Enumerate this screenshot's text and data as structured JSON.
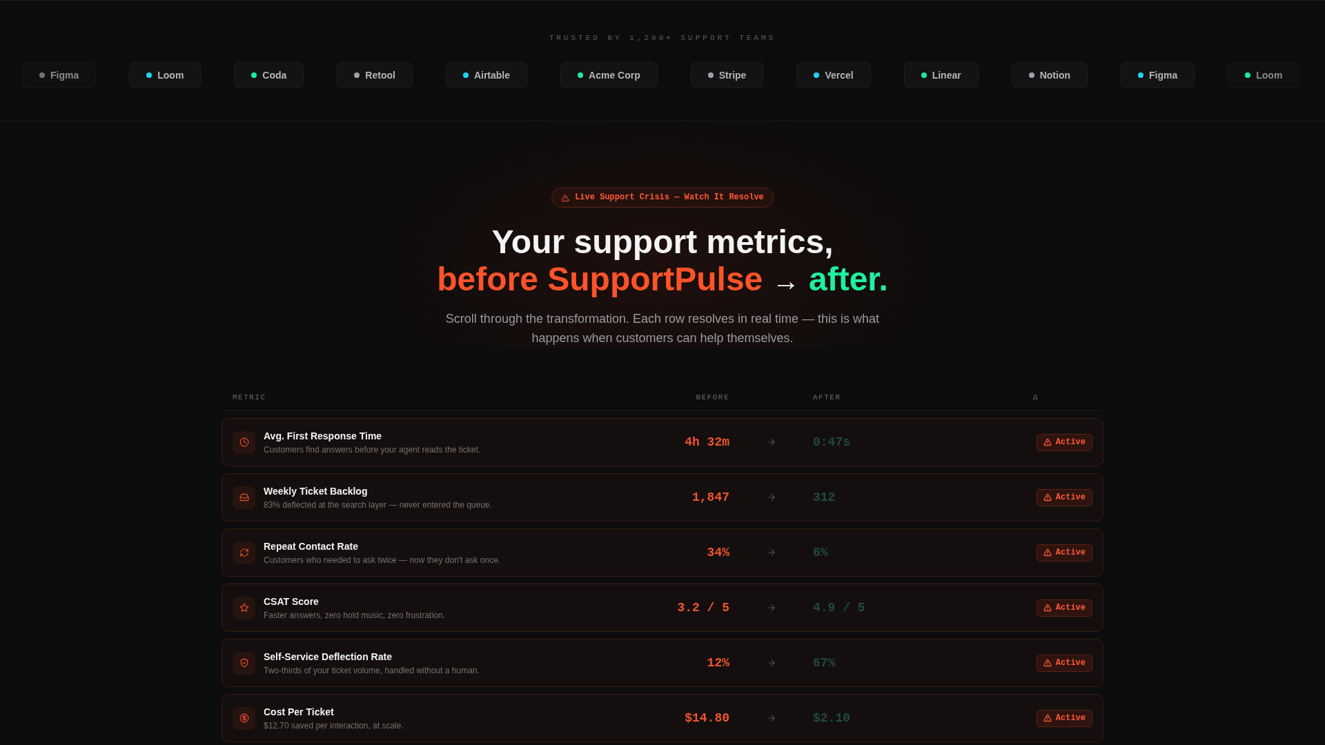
{
  "trusted_by": {
    "label": "TRUSTED BY 1,200+ SUPPORT TEAMS",
    "logos": [
      {
        "name": "Figma",
        "color": "#717175"
      },
      {
        "name": "Loom",
        "color": "#22d3ee"
      },
      {
        "name": "Coda",
        "color": "#1de9a0"
      },
      {
        "name": "Retool",
        "color": "#a1a1aa"
      },
      {
        "name": "Airtable",
        "color": "#22d3ee"
      },
      {
        "name": "Acme Corp",
        "color": "#1de9a0"
      },
      {
        "name": "Stripe",
        "color": "#a1a1aa"
      },
      {
        "name": "Vercel",
        "color": "#22d3ee"
      },
      {
        "name": "Linear",
        "color": "#1de9a0"
      },
      {
        "name": "Notion",
        "color": "#a1a1aa"
      },
      {
        "name": "Figma",
        "color": "#22d3ee"
      },
      {
        "name": "Loom",
        "color": "#1de9a0"
      }
    ]
  },
  "hero": {
    "badge": "Live Support Crisis — Watch It Resolve",
    "headline": {
      "line_1": "Your support metrics,",
      "before": "before SupportPulse",
      "arrow": "→",
      "after": "after."
    },
    "subtitle": "Scroll through the transformation. Each row resolves in real time — this is what happens when customers can help themselves."
  },
  "table": {
    "columns": [
      "METRIC",
      "BEFORE",
      "AFTER",
      "Δ"
    ],
    "rows": [
      {
        "kind": "time",
        "title": "Avg. First Response Time",
        "description": "Customers find answers before your agent reads the ticket.",
        "before": "4h 32m",
        "after": "0:47s",
        "status": "Active"
      },
      {
        "kind": "backlog",
        "title": "Weekly Ticket Backlog",
        "description": "83% deflected at the search layer — never entered the queue.",
        "before": "1,847",
        "after": "312",
        "status": "Active"
      },
      {
        "kind": "repeat",
        "title": "Repeat Contact Rate",
        "description": "Customers who needed to ask twice — now they don't ask once.",
        "before": "34%",
        "after": "6%",
        "status": "Active"
      },
      {
        "kind": "rating",
        "title": "CSAT Score",
        "description": "Faster answers, zero hold music, zero frustration.",
        "before": "3.2 / 5",
        "after": "4.9 / 5",
        "status": "Active"
      },
      {
        "kind": "deflection",
        "title": "Self-Service Deflection Rate",
        "description": "Two-thirds of your ticket volume, handled without a human.",
        "before": "12%",
        "after": "67%",
        "status": "Active"
      },
      {
        "kind": "cost",
        "title": "Cost Per Ticket",
        "description": "$12.70 saved per interaction, at scale.",
        "before": "$14.80",
        "after": "$2.10",
        "status": "Active"
      }
    ]
  }
}
